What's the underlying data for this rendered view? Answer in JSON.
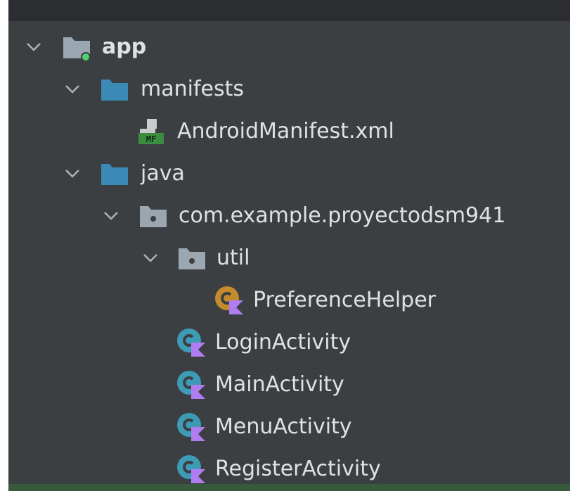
{
  "project_tree": {
    "nodes": [
      {
        "label": "app",
        "icon": "module-folder-icon",
        "expanded": true,
        "depth": 0
      },
      {
        "label": "manifests",
        "icon": "folder-icon",
        "expanded": true,
        "depth": 1
      },
      {
        "label": "AndroidManifest.xml",
        "icon": "android-manifest-file-icon",
        "depth": 2
      },
      {
        "label": "java",
        "icon": "source-folder-icon",
        "expanded": true,
        "depth": 1
      },
      {
        "label": "com.example.proyectodsm941",
        "icon": "package-icon",
        "expanded": true,
        "depth": 2
      },
      {
        "label": "util",
        "icon": "package-icon",
        "expanded": true,
        "depth": 3
      },
      {
        "label": "PreferenceHelper",
        "icon": "kotlin-object-icon",
        "depth": 4
      },
      {
        "label": "LoginActivity",
        "icon": "kotlin-class-icon",
        "depth": 3
      },
      {
        "label": "MainActivity",
        "icon": "kotlin-class-icon",
        "depth": 3
      },
      {
        "label": "MenuActivity",
        "icon": "kotlin-class-icon",
        "depth": 3
      },
      {
        "label": "RegisterActivity",
        "icon": "kotlin-class-icon",
        "depth": 3
      }
    ]
  },
  "colors": {
    "background": "#3c3f41",
    "text": "#dfe1e5",
    "folder_blue": "#3b8ab5",
    "module_grey": "#9aa7b0",
    "package_grey": "#9aa7b0",
    "kotlin_class_teal": "#3d9bb6",
    "kotlin_object_orange": "#c48a2c",
    "kotlin_purple": "#b17cf0",
    "manifest_green": "#3c8d40"
  }
}
